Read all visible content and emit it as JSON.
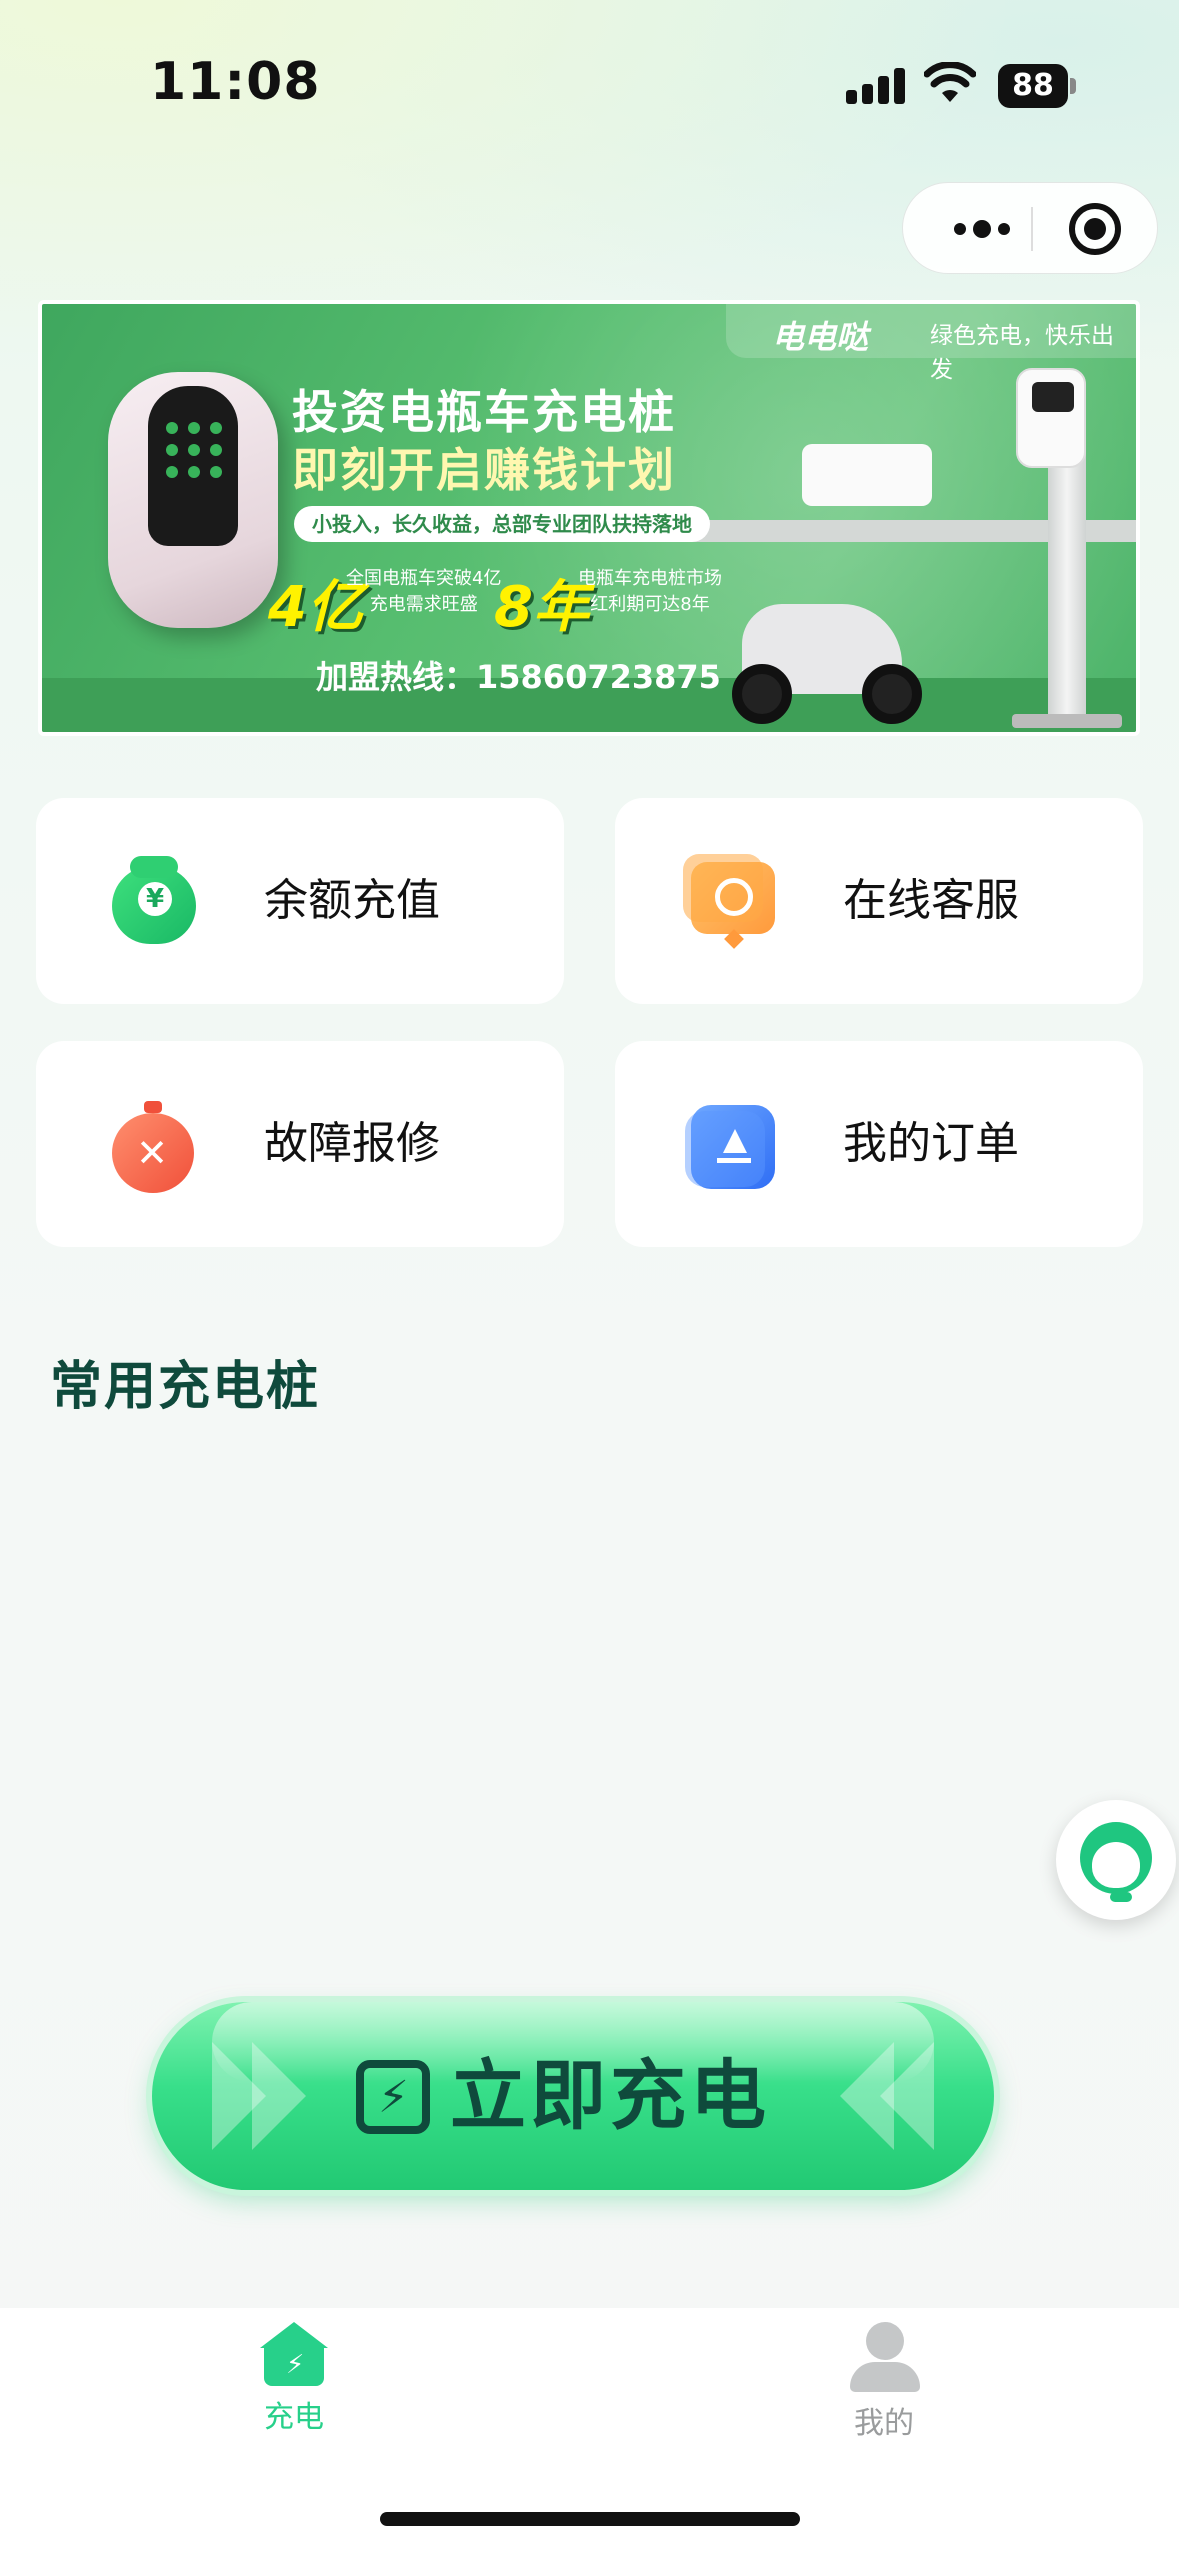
{
  "status_bar": {
    "time": "11:08",
    "battery": "88"
  },
  "banner": {
    "brand": "电电哒",
    "slogan": "绿色充电，快乐出发",
    "headline1": "投资电瓶车充电桩",
    "headline2": "即刻开启赚钱计划",
    "pill": "小投入，长久收益，总部专业团队扶持落地",
    "stat1_value": "4亿",
    "stat1_line1": "全国电瓶车突破4亿",
    "stat1_line2": "充电需求旺盛",
    "stat2_value": "8年",
    "stat2_line1": "电瓶车充电桩市场",
    "stat2_line2": "红利期可达8年",
    "hotline": "加盟热线：15860723875"
  },
  "cards": [
    {
      "label": "余额充值",
      "icon": "money-bag-icon",
      "color": "#19b865"
    },
    {
      "label": "在线客服",
      "icon": "chat-service-icon",
      "color": "#ff9a3c"
    },
    {
      "label": "故障报修",
      "icon": "repair-tools-icon",
      "color": "#f0503a"
    },
    {
      "label": "我的订单",
      "icon": "order-document-icon",
      "color": "#2f6ef5"
    }
  ],
  "section": {
    "title": "常用充电桩"
  },
  "charge_button": {
    "label": "立即充电"
  },
  "tabbar": {
    "items": [
      {
        "label": "充电",
        "active": true,
        "color": "#27d08a"
      },
      {
        "label": "我的",
        "active": false,
        "color": "#9a9c9d"
      }
    ]
  },
  "colors": {
    "accent": "#27d08a",
    "title": "#0f4a3c"
  }
}
